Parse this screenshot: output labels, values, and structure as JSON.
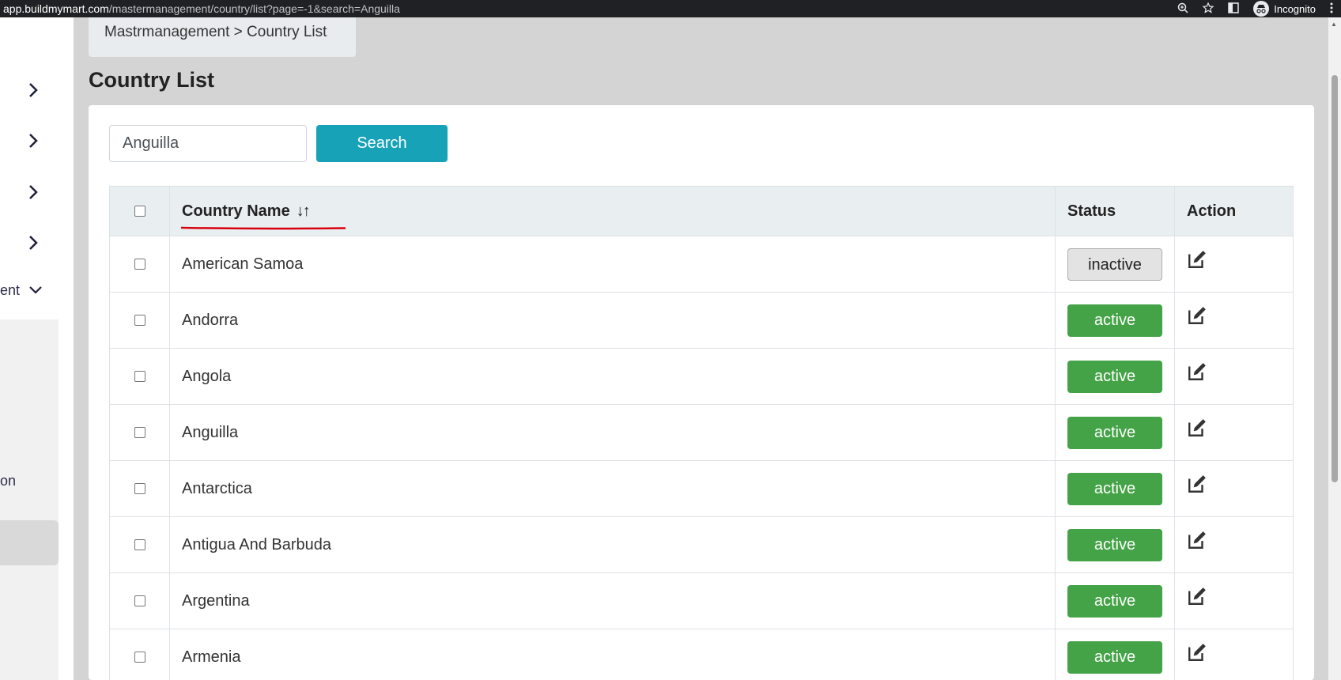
{
  "browser": {
    "url_host": "app.buildmymart.com",
    "url_path": "/mastermanagement/country/list?page=-1&search=Anguilla",
    "incognito_label": "Incognito"
  },
  "sidebar": {
    "partial_label_1": "ent",
    "partial_label_2": "on"
  },
  "breadcrumb": "Mastrmanagement > Country List",
  "page_title": "Country List",
  "search": {
    "value": "Anguilla",
    "button_label": "Search"
  },
  "table": {
    "headers": {
      "name": "Country Name",
      "sort_glyph": "↓↑",
      "status": "Status",
      "action": "Action"
    },
    "rows": [
      {
        "name": "American Samoa",
        "status": "inactive"
      },
      {
        "name": "Andorra",
        "status": "active"
      },
      {
        "name": "Angola",
        "status": "active"
      },
      {
        "name": "Anguilla",
        "status": "active"
      },
      {
        "name": "Antarctica",
        "status": "active"
      },
      {
        "name": "Antigua And Barbuda",
        "status": "active"
      },
      {
        "name": "Argentina",
        "status": "active"
      },
      {
        "name": "Armenia",
        "status": "active"
      }
    ]
  },
  "colors": {
    "active": "#45a347",
    "inactive": "#e3e3e3",
    "search_button": "#17a2b8",
    "annotation": "#d9000d"
  }
}
